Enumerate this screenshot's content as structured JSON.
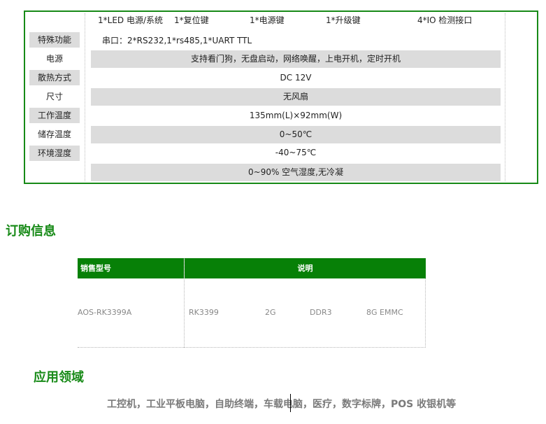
{
  "spec": {
    "top_row": [
      "1*LED 电源/系统",
      "1*复位键",
      "1*电源键",
      "1*升级键",
      "4*IO 检测接口"
    ],
    "serial": "串口：2*RS232,1*rs485,1*UART TTL",
    "labels": [
      "特殊功能",
      "电源",
      "散热方式",
      "尺寸",
      "工作温度",
      "储存温度",
      "环境湿度"
    ],
    "values": [
      "支持看门狗，无盘启动，网络唤醒，上电开机，定时开机",
      "DC 12V",
      "无风扇",
      "135mm(L)×92mm(W)",
      "0~50℃",
      "-40~75℃",
      "0~90%  空气湿度,无冷凝"
    ]
  },
  "order": {
    "title": "订购信息",
    "headers": [
      "销售型号",
      "说明"
    ],
    "model": "AOS-RK3399A",
    "desc": [
      "RK3399",
      "2G",
      "DDR3",
      "8G EMMC"
    ]
  },
  "apps": {
    "title": "应用领域",
    "text": "工控机，工业平板电脑，自助终端，车载电脑，医疗，数字标牌，POS  收银机等"
  }
}
